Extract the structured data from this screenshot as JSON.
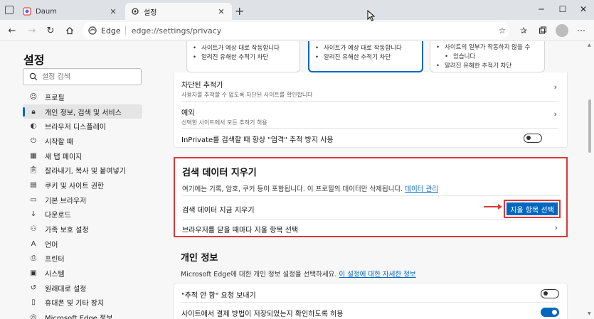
{
  "browser": {
    "tabs": [
      {
        "label": "Daum",
        "active": false
      },
      {
        "label": "설정",
        "active": true
      }
    ],
    "address": {
      "brand": "Edge",
      "url": "edge://settings/privacy"
    },
    "window_controls": {
      "minimize": "─",
      "maximize": "☐",
      "close": "✕"
    }
  },
  "sidebar": {
    "title": "설정",
    "search_placeholder": "설정 검색",
    "items": [
      {
        "label": "프로필",
        "icon": "profile-icon",
        "selected": false
      },
      {
        "label": "개인 정보, 검색 및 서비스",
        "icon": "lock-icon",
        "selected": true
      },
      {
        "label": "브라우저 디스플레이",
        "icon": "appearance-icon",
        "selected": false
      },
      {
        "label": "시작할 때",
        "icon": "power-icon",
        "selected": false
      },
      {
        "label": "새 탭 페이지",
        "icon": "newtab-icon",
        "selected": false
      },
      {
        "label": "잘라내기, 복사 및 붙여넣기",
        "icon": "clipboard-icon",
        "selected": false
      },
      {
        "label": "쿠키 및 사이트 권한",
        "icon": "site-permissions-icon",
        "selected": false
      },
      {
        "label": "기본 브라우저",
        "icon": "browser-icon",
        "selected": false
      },
      {
        "label": "다운로드",
        "icon": "download-icon",
        "selected": false
      },
      {
        "label": "가족 보호 설정",
        "icon": "family-icon",
        "selected": false
      },
      {
        "label": "언어",
        "icon": "language-icon",
        "selected": false
      },
      {
        "label": "프린터",
        "icon": "printer-icon",
        "selected": false
      },
      {
        "label": "시스템",
        "icon": "system-icon",
        "selected": false
      },
      {
        "label": "원래대로 설정",
        "icon": "reset-icon",
        "selected": false
      },
      {
        "label": "휴대폰 및 기타 장치",
        "icon": "phone-icon",
        "selected": false
      },
      {
        "label": "Microsoft Edge 정보",
        "icon": "edge-icon",
        "selected": false
      }
    ]
  },
  "tracking": {
    "cards": [
      {
        "bullets": [
          "사이트가 예상 대로 작동합니다",
          "알려진 유해한 추적기 차단"
        ],
        "selected": false
      },
      {
        "bullets": [
          "사이트가 예상 대로 작동합니다",
          "알려진 유해한 추적기 차단"
        ],
        "selected": true
      },
      {
        "bullets": [
          "사이트의 일부가 작동하지 않을 수",
          "있습니다",
          "알려진 유해한 추적기 차단"
        ],
        "selected": false
      }
    ],
    "blocked": {
      "title": "차단된 추적기",
      "sub": "사용자를 추적할 수 없도록 차단된 사이트를 확인합니다"
    },
    "exceptions": {
      "title": "예외",
      "sub": "선택한 사이트에서 모든 추적기 허용"
    },
    "inprivate": {
      "label": "InPrivate를 검색할 때 항상 \"엄격\" 추적 방지 사용",
      "on": false
    }
  },
  "clear_data": {
    "title": "검색 데이터 지우기",
    "desc": "여기에는 기록, 암호, 쿠키 등이 포함됩니다. 이 프로필의 데이터만 삭제됩니다.",
    "manage_link": "데이터 관리",
    "clear_now_label": "검색 데이터 지금 지우기",
    "choose_button": "지울 항목 선택",
    "on_close_label": "브라우저를 닫을 때마다 지울 항목 선택"
  },
  "privacy": {
    "title": "개인 정보",
    "desc": "Microsoft Edge에 대한 개인 정보 설정을 선택하세요.",
    "more_link": "이 설정에 대한 자세한 정보",
    "dnt": {
      "label": "\"추적 안 함\" 요청 보내기",
      "on": false
    },
    "payment": {
      "label": "사이트에서 결제 방법이 저장되었는지 확인하도록 허용",
      "on": true
    }
  }
}
